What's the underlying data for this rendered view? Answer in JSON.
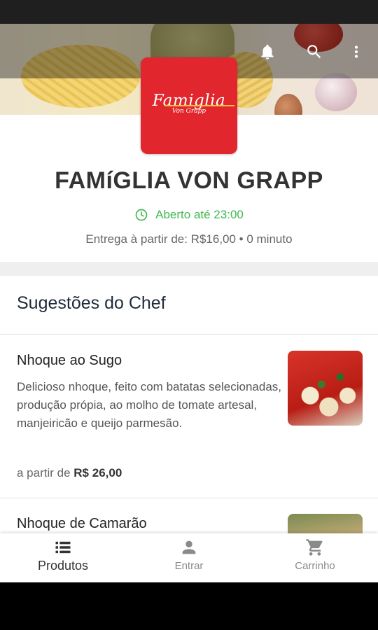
{
  "restaurant": {
    "name": "FAMíGLIA VON GRAPP",
    "logo_text": "Famiglia",
    "logo_subtext": "Von Grapp",
    "open_status": "Aberto até 23:00",
    "delivery_info": "Entrega à partir de: R$16,00 • 0 minuto"
  },
  "colors": {
    "brand_red": "#e1262d",
    "open_green": "#3fb950"
  },
  "topbar": {
    "icons": [
      "bell-icon",
      "search-icon",
      "more-vert-icon"
    ]
  },
  "section": {
    "title": "Sugestões do Chef"
  },
  "products": [
    {
      "name": "Nhoque ao Sugo",
      "description": "Delicioso nhoque, feito com batatas selecionadas, produção própia, ao molho de tomate artesal, manjeiricão e queijo parmesão.",
      "price_prefix": "a partir de",
      "price": "R$ 26,00"
    },
    {
      "name": "Nhoque de Camarão"
    }
  ],
  "bottom_nav": [
    {
      "label": "Produtos",
      "icon": "list-icon",
      "active": true
    },
    {
      "label": "Entrar",
      "icon": "person-icon",
      "active": false
    },
    {
      "label": "Carrinho",
      "icon": "cart-icon",
      "active": false
    }
  ]
}
